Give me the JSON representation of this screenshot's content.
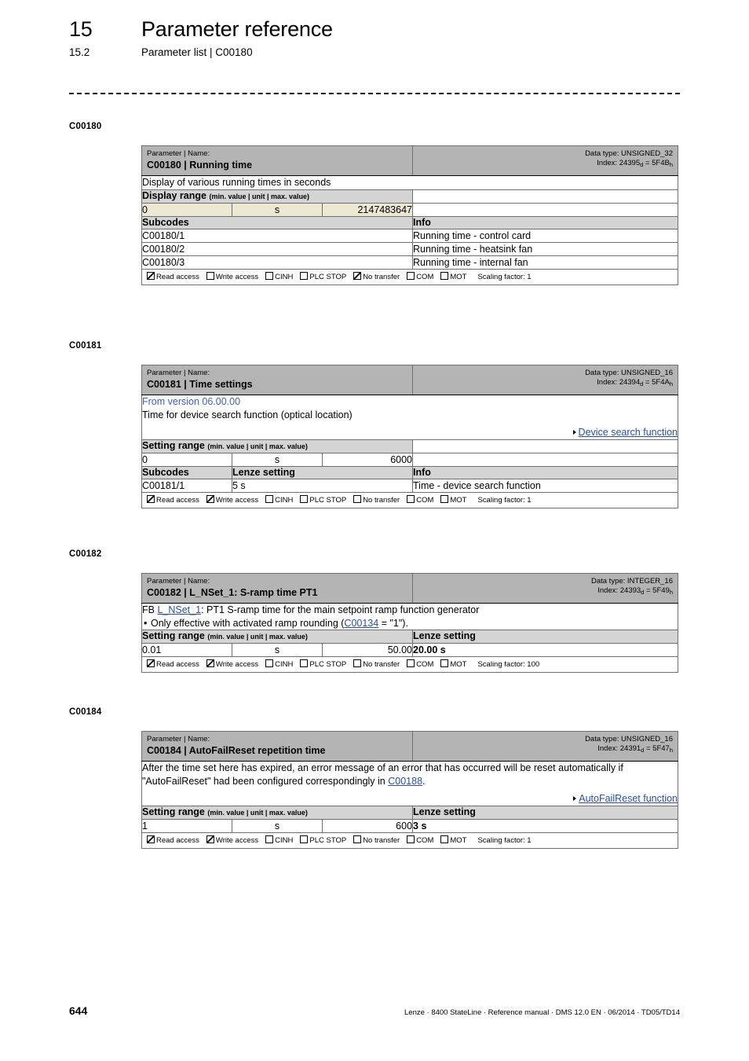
{
  "header": {
    "chapter_number": "15",
    "chapter_title": "Parameter reference",
    "section_number": "15.2",
    "section_title": "Parameter list | C00180"
  },
  "labels": {
    "param_name_caption": "Parameter | Name:",
    "display_range": "Display range",
    "setting_range": "Setting range",
    "range_sub": "(min. value | unit | max. value)",
    "subcodes": "Subcodes",
    "info": "Info",
    "lenze_setting": "Lenze setting",
    "read_access": "Read access",
    "write_access": "Write access",
    "cinh": "CINH",
    "plc_stop": "PLC STOP",
    "no_transfer": "No transfer",
    "com": "COM",
    "mot": "MOT"
  },
  "blocks": [
    {
      "code": "C00180",
      "title": "C00180 | Running time",
      "data_type": "Data type: UNSIGNED_32",
      "index_prefix": "Index: 24395",
      "index_mid": " = 5F4B",
      "description": "Display of various running times in seconds",
      "range_label": "Display range",
      "range_beige": true,
      "range_min": "0",
      "range_unit": "s",
      "range_max": "2147483647",
      "lenze_value": "",
      "has_lenze_col": false,
      "subcodes_has_lenze": false,
      "subcodes": [
        {
          "code": "C00180/1",
          "lenze": "",
          "info": "Running time - control card"
        },
        {
          "code": "C00180/2",
          "lenze": "",
          "info": "Running time - heatsink fan"
        },
        {
          "code": "C00180/3",
          "lenze": "",
          "info": "Running time - internal fan"
        }
      ],
      "access": {
        "read": true,
        "write": false,
        "cinh": false,
        "plc_stop": false,
        "no_transfer": true,
        "com": false,
        "mot": false
      },
      "scaling": "Scaling factor: 1"
    },
    {
      "code": "C00181",
      "title": "C00181 | Time settings",
      "data_type": "Data type: UNSIGNED_16",
      "index_prefix": "Index: 24394",
      "index_mid": " = 5F4A",
      "version_note": "From version 06.00.00",
      "description": "Time for device search function (optical location)",
      "xref": "Device search function",
      "range_label": "Setting range",
      "range_beige": false,
      "range_min": "0",
      "range_unit": "s",
      "range_max": "6000",
      "has_lenze_col": false,
      "subcodes_has_lenze": true,
      "subcodes": [
        {
          "code": "C00181/1",
          "lenze": "5 s",
          "info": "Time - device search function"
        }
      ],
      "access": {
        "read": true,
        "write": true,
        "cinh": false,
        "plc_stop": false,
        "no_transfer": false,
        "com": false,
        "mot": false
      },
      "scaling": "Scaling factor: 1"
    },
    {
      "code": "C00182",
      "title": "C00182 | L_NSet_1: S-ramp time PT1",
      "data_type": "Data type: INTEGER_16",
      "index_prefix": "Index: 24393",
      "index_mid": " = 5F49",
      "desc_fb_prefix": "FB ",
      "desc_fb_link": "L_NSet_1",
      "desc_fb_rest": ": PT1 S-ramp time for the main setpoint ramp function generator",
      "bullet_prefix": "Only effective with activated ramp rounding (",
      "bullet_link": "C00134",
      "bullet_rest": " = \"1\").",
      "range_label": "Setting range",
      "range_beige": false,
      "range_min": "0.01",
      "range_unit": "s",
      "range_max": "50.00",
      "lenze_value": "20.00 s",
      "has_lenze_col": true,
      "subcodes": [],
      "access": {
        "read": true,
        "write": true,
        "cinh": false,
        "plc_stop": false,
        "no_transfer": false,
        "com": false,
        "mot": false
      },
      "scaling": "Scaling factor: 100"
    },
    {
      "code": "C00184",
      "title": "C00184 | AutoFailReset repetition time",
      "data_type": "Data type: UNSIGNED_16",
      "index_prefix": "Index: 24391",
      "index_mid": " = 5F47",
      "desc_part1": "After the time set here has expired, an error message of an error that has occurred will be reset automatically if \"AutoFailReset\" had been configured correspondingly in ",
      "desc_link": "C00188",
      "desc_part2": ".",
      "xref": "AutoFailReset function",
      "range_label": "Setting range",
      "range_beige": false,
      "range_min": "1",
      "range_unit": "s",
      "range_max": "600",
      "lenze_value": "3 s",
      "has_lenze_col": true,
      "subcodes": [],
      "access": {
        "read": true,
        "write": true,
        "cinh": false,
        "plc_stop": false,
        "no_transfer": false,
        "com": false,
        "mot": false
      },
      "scaling": "Scaling factor: 1"
    }
  ],
  "footer": {
    "page_number": "644",
    "imprint": "Lenze · 8400 StateLine · Reference manual · DMS 12.0 EN · 06/2014 · TD05/TD14"
  },
  "index_sub_d": "d",
  "index_sub_h": "h"
}
